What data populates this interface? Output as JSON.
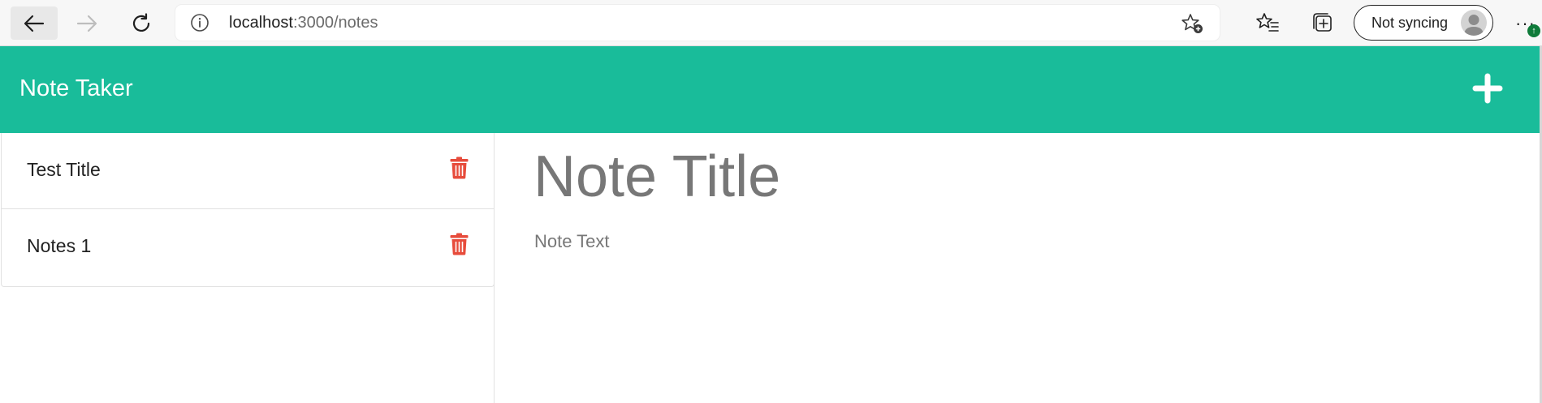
{
  "browser": {
    "url_host": "localhost",
    "url_path": ":3000/notes",
    "sync_label": "Not syncing",
    "more_label": "···",
    "update_badge": "↑"
  },
  "app": {
    "title": "Note Taker",
    "accent_color": "#19bc9a",
    "delete_color": "#e74c3c",
    "notes": [
      {
        "title": "Test Title"
      },
      {
        "title": "Notes 1"
      }
    ],
    "editor": {
      "title_placeholder": "Note Title",
      "text_placeholder": "Note Text"
    }
  },
  "icons": {
    "back": "arrow-left-icon",
    "forward": "arrow-right-icon",
    "refresh": "refresh-icon",
    "info": "info-icon",
    "favorite_add": "star-plus-icon",
    "favorites": "favorites-list-icon",
    "collections": "collections-icon",
    "new_note": "plus-icon",
    "delete": "trash-icon"
  }
}
